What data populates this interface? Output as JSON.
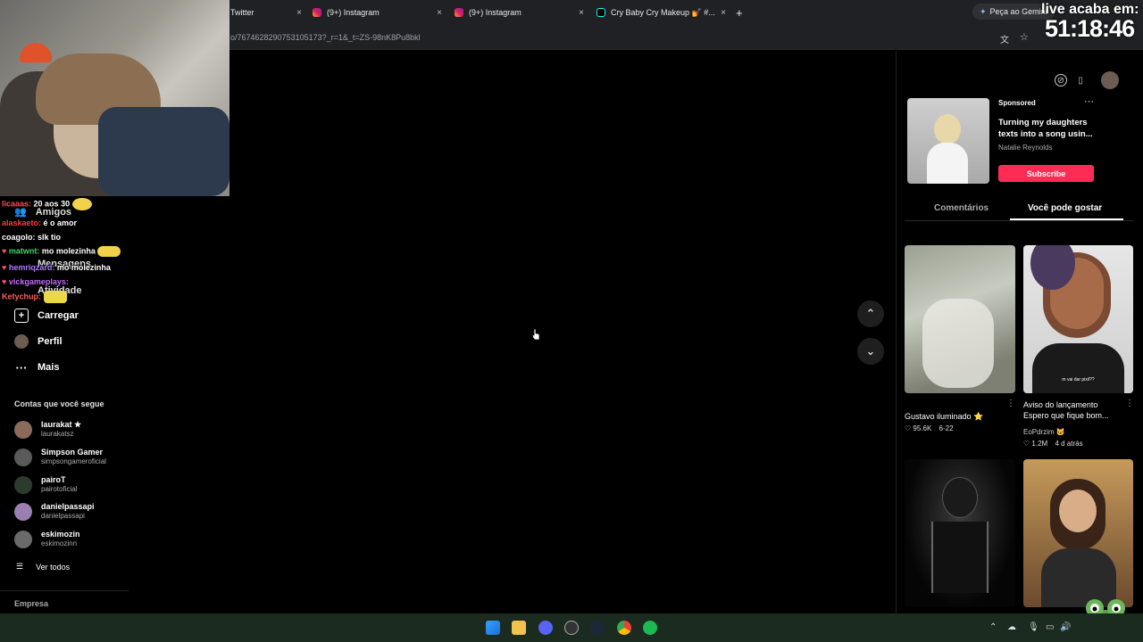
{
  "browser": {
    "tabs": [
      {
        "label": "Twitter"
      },
      {
        "label": "(9+) Instagram"
      },
      {
        "label": "(9+) Instagram"
      },
      {
        "label": "Cry Baby Cry Makeup 💅 #..."
      }
    ],
    "new_tab": "+",
    "close": "×",
    "url": "o/7674628290753105173?_r=1&_t=ZS-98nK8Pu8bkl",
    "gemini_label": "Peça ao Gemini"
  },
  "overlay": {
    "timer_label": "live acaba em:",
    "timer_value": "51:18:46"
  },
  "chat": [
    {
      "user": "licaaas:",
      "msg": "20 aos 30",
      "color": "#ff4f4f"
    },
    {
      "user": "alaskaeto:",
      "msg": "é o amor",
      "color": "#ff3c3c"
    },
    {
      "user": "coagolo:",
      "msg": "slk tio",
      "color": "#ffffff"
    },
    {
      "user": "matwnt:",
      "msg": "mo molezinha",
      "color": "#45d16b"
    },
    {
      "user": "hemriqzard:",
      "msg": "mo molezinha",
      "color": "#b07cff"
    },
    {
      "user": "vickgameplays:",
      "msg": "",
      "color": "#c46bff"
    },
    {
      "user": "Ketychup:",
      "msg": "",
      "color": "#ff5a5a"
    }
  ],
  "sidebar": {
    "hidden_items": [
      "Amigos",
      "Mensagens",
      "Atividade"
    ],
    "items": [
      {
        "label": "Carregar",
        "icon": "plus-square-icon"
      },
      {
        "label": "Perfil",
        "icon": "avatar"
      },
      {
        "label": "Mais",
        "icon": "more-icon"
      }
    ],
    "following_title": "Contas que você segue",
    "following": [
      {
        "name": "laurakat ★",
        "handle": "laurakatsz"
      },
      {
        "name": "Simpson Gamer",
        "handle": "simpsongameroficial"
      },
      {
        "name": "pairoT",
        "handle": "pairotoficial"
      },
      {
        "name": "danielpassapi",
        "handle": "danielpassapi"
      },
      {
        "name": "eskimozin",
        "handle": "eskimozinn"
      }
    ],
    "see_all": "Ver todos",
    "company": "Empresa"
  },
  "player": {
    "up_arrow": "⌃",
    "down_arrow": "⌄"
  },
  "right_panel": {
    "ad": {
      "sponsored": "Sponsored",
      "more": "···",
      "title": "Turning my daughters texts into a song usin...",
      "author": "Natalie Reynolds",
      "subscribe": "Subscribe"
    },
    "tabs": {
      "comments": "Comentários",
      "for_you": "Você pode gostar"
    },
    "videos": [
      {
        "caption": "Gustavo iluminado ⭐",
        "likes": "95.6K",
        "date": "6-22",
        "author": ""
      },
      {
        "caption": "Aviso do lançamento Espero que fique bom...",
        "likes": "1.2M",
        "date": "4 d atrás",
        "author": "EoPdrzim 🐱"
      }
    ],
    "thumb_overlay": "m vai dar pixil??"
  },
  "colors": {
    "accent": "#fe2c55",
    "bg": "#000000",
    "chrome": "#202124"
  }
}
